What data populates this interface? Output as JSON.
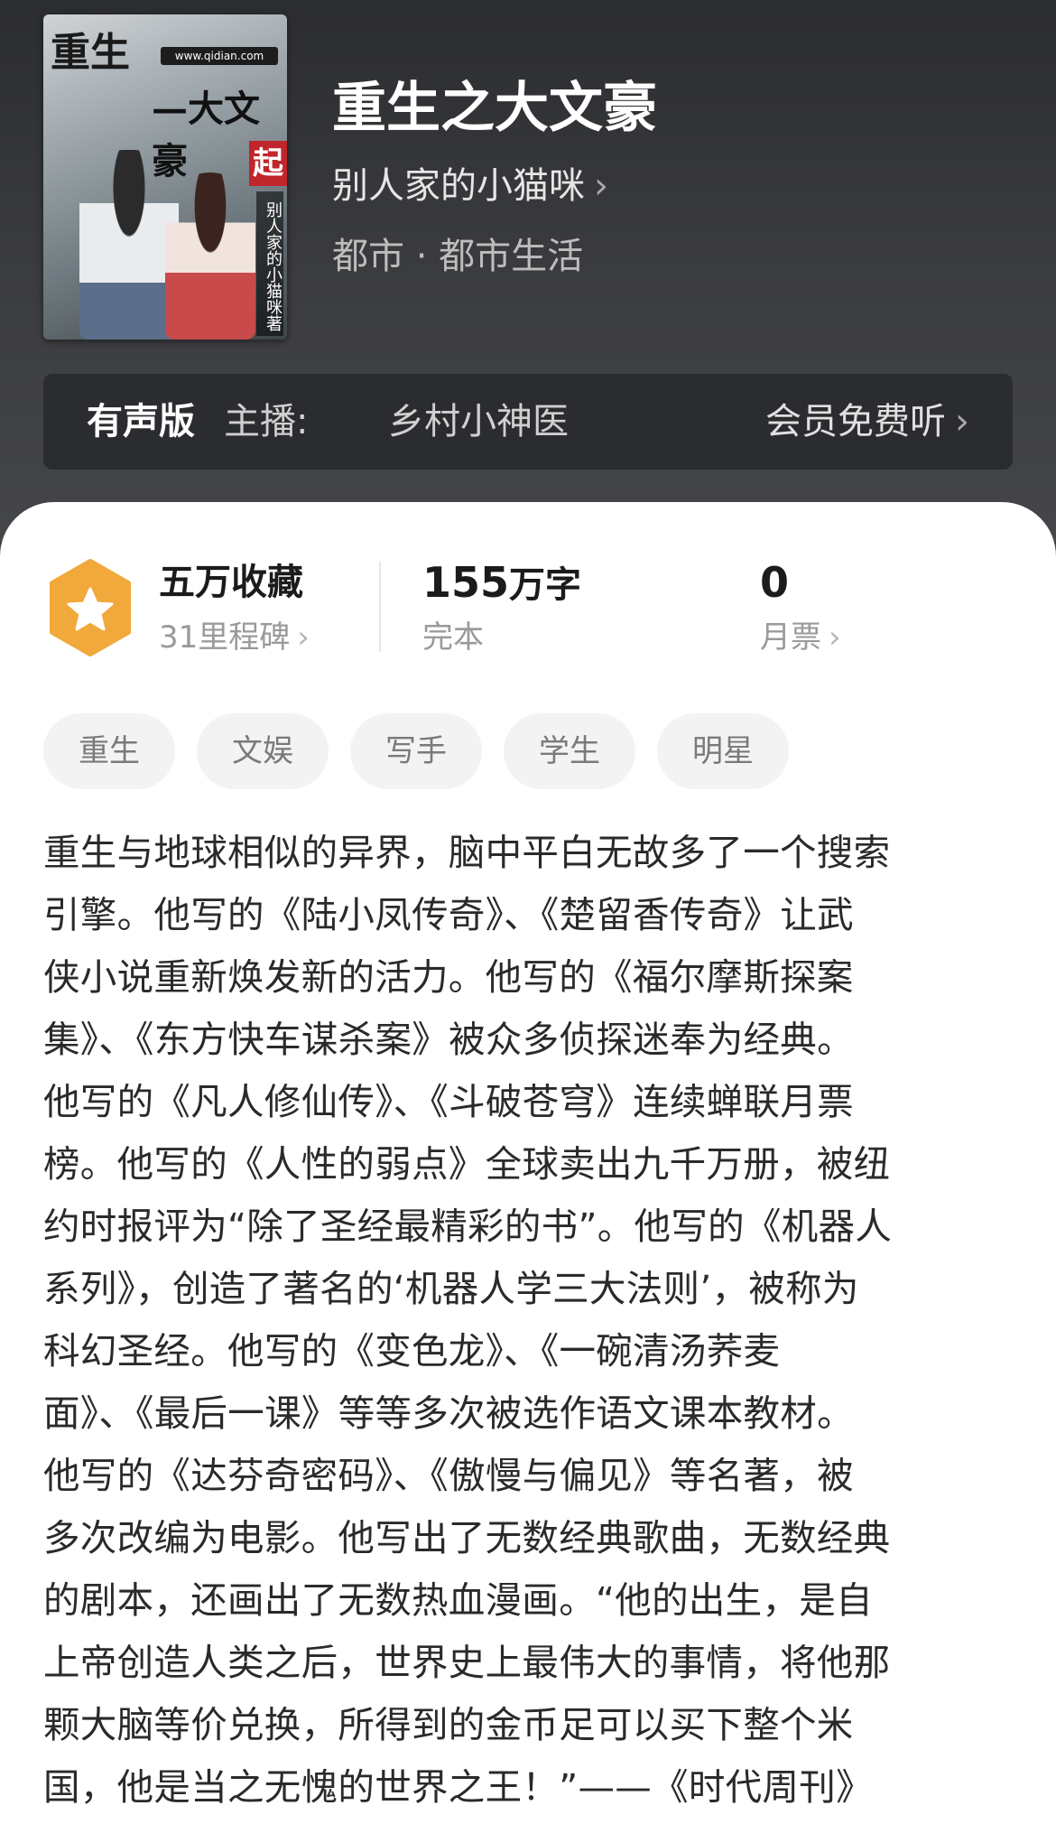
{
  "book": {
    "title": "重生之大文豪",
    "author": "别人家的小猫咪",
    "author_chevron": "›",
    "genre": "都市 · 都市生活",
    "cover": {
      "title_text": "重生",
      "url_text": "www.qidian.com",
      "subtitle_text": "—大文豪",
      "seal_text": "起",
      "author_text": "别人家的小猫咪著"
    }
  },
  "audio": {
    "label": "有声版",
    "narrator_prefix": "主播:",
    "narrator": "乡村小神医",
    "listen_label": "会员免费听",
    "chevron": "›"
  },
  "stats": {
    "collection": {
      "title": "五万收藏",
      "sub": "31里程碑",
      "icon": "star-hexagon-icon",
      "color": "#f2a93b"
    },
    "words": {
      "value": "155",
      "unit": "万字",
      "sub": "完本"
    },
    "monthly": {
      "value": "0",
      "sub": "月票"
    },
    "chevron": "›"
  },
  "tags": [
    "重生",
    "文娱",
    "写手",
    "学生",
    "明星"
  ],
  "description_lines": [
    "重生与地球相似的异界，脑中平白无故多了一个搜索",
    "引擎。他写的《陆小凤传奇》、《楚留香传奇》让武",
    "侠小说重新焕发新的活力。他写的《福尔摩斯探案",
    "集》、《东方快车谋杀案》被众多侦探迷奉为经典。",
    "他写的《凡人修仙传》、《斗破苍穹》连续蝉联月票",
    "榜。他写的《人性的弱点》全球卖出九千万册，被纽",
    "约时报评为“除了圣经最精彩的书”。他写的《机器人",
    "系列》，创造了著名的‘机器人学三大法则’，被称为",
    "科幻圣经。他写的《变色龙》、《一碗清汤荞麦",
    "面》、《最后一课》等等多次被选作语文课本教材。",
    "他写的《达芬奇密码》、《傲慢与偏见》等名著，被",
    "多次改编为电影。他写出了无数经典歌曲，无数经典",
    "的剧本，还画出了无数热血漫画。“他的出生，是自",
    "上帝创造人类之后，世界史上最伟大的事情，将他那",
    "颗大脑等价兑换，所得到的金币足可以买下整个米",
    "国，他是当之无愧的世界之王！”——《时代周刊》"
  ],
  "colors": {
    "header_bg": "#3a3b3e",
    "card_bg": "#ffffff",
    "accent_orange": "#f2a93b"
  }
}
